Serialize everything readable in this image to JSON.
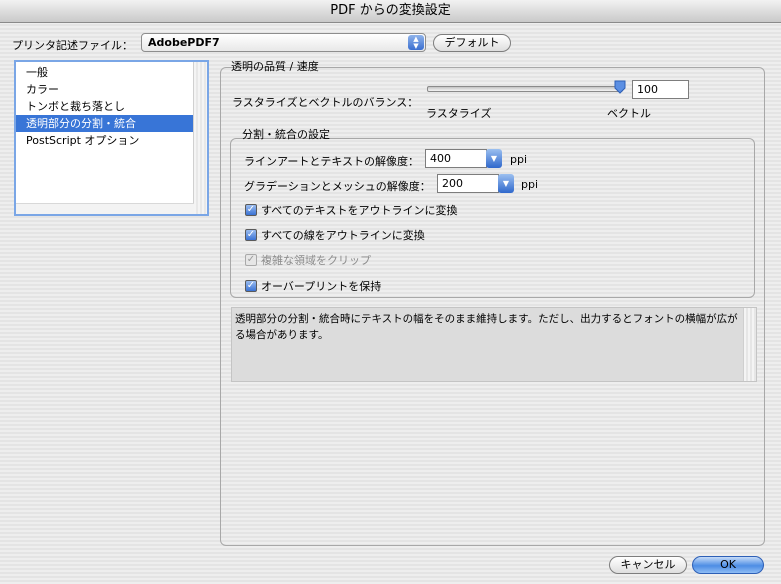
{
  "window": {
    "title": "PDF からの変換設定"
  },
  "printer_file": {
    "label": "プリンタ記述ファイル：",
    "value": "AdobePDF7",
    "default_button": "デフォルト"
  },
  "sidebar": {
    "items": [
      {
        "label": "一般",
        "selected": false
      },
      {
        "label": "カラー",
        "selected": false
      },
      {
        "label": "トンボと裁ち落とし",
        "selected": false
      },
      {
        "label": "透明部分の分割・統合",
        "selected": true
      },
      {
        "label": "PostScript オプション",
        "selected": false
      }
    ]
  },
  "quality": {
    "group_label": "透明の品質 / 速度",
    "balance_label": "ラスタライズとベクトルのバランス：",
    "slider_value": "100",
    "slider_level": 1.0,
    "left_label": "ラスタライズ",
    "right_label": "ベクトル"
  },
  "flatten": {
    "group_label": "分割・統合の設定",
    "line_art": {
      "label": "ラインアートとテキストの解像度：",
      "value": "400",
      "unit": "ppi"
    },
    "gradient": {
      "label": "グラデーションとメッシュの解像度：",
      "value": "200",
      "unit": "ppi"
    },
    "checks": [
      {
        "label": "すべてのテキストをアウトラインに変換",
        "checked": true,
        "enabled": true
      },
      {
        "label": "すべての線をアウトラインに変換",
        "checked": true,
        "enabled": true
      },
      {
        "label": "複雑な領域をクリップ",
        "checked": true,
        "enabled": false
      },
      {
        "label": "オーバープリントを保持",
        "checked": true,
        "enabled": true
      }
    ]
  },
  "description": "透明部分の分割・統合時にテキストの幅をそのまま維持します。ただし、出力するとフォントの横幅が広がる場合があります。",
  "buttons": {
    "cancel": "キャンセル",
    "ok": "OK"
  },
  "colors": {
    "selection": "#3875d7",
    "accent_blue": "#3a72d4"
  }
}
